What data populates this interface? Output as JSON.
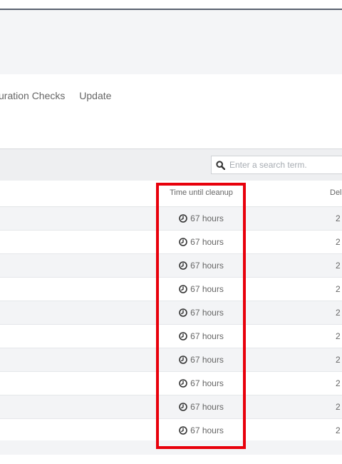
{
  "nav": {
    "items": [
      {
        "label": "uration Checks"
      },
      {
        "label": "Update"
      }
    ]
  },
  "search": {
    "placeholder": "Enter a search term.",
    "icon": "search-icon"
  },
  "table": {
    "columns": {
      "time": "Time until cleanup",
      "deleted": "Del"
    },
    "rows": [
      {
        "time": "67 hours",
        "deleted": "2"
      },
      {
        "time": "67 hours",
        "deleted": "2"
      },
      {
        "time": "67 hours",
        "deleted": "2"
      },
      {
        "time": "67 hours",
        "deleted": "2"
      },
      {
        "time": "67 hours",
        "deleted": "2"
      },
      {
        "time": "67 hours",
        "deleted": "2"
      },
      {
        "time": "67 hours",
        "deleted": "2"
      },
      {
        "time": "67 hours",
        "deleted": "2"
      },
      {
        "time": "67 hours",
        "deleted": "2"
      },
      {
        "time": "67 hours",
        "deleted": "2"
      }
    ]
  },
  "highlight": {
    "color": "#e8000b"
  }
}
